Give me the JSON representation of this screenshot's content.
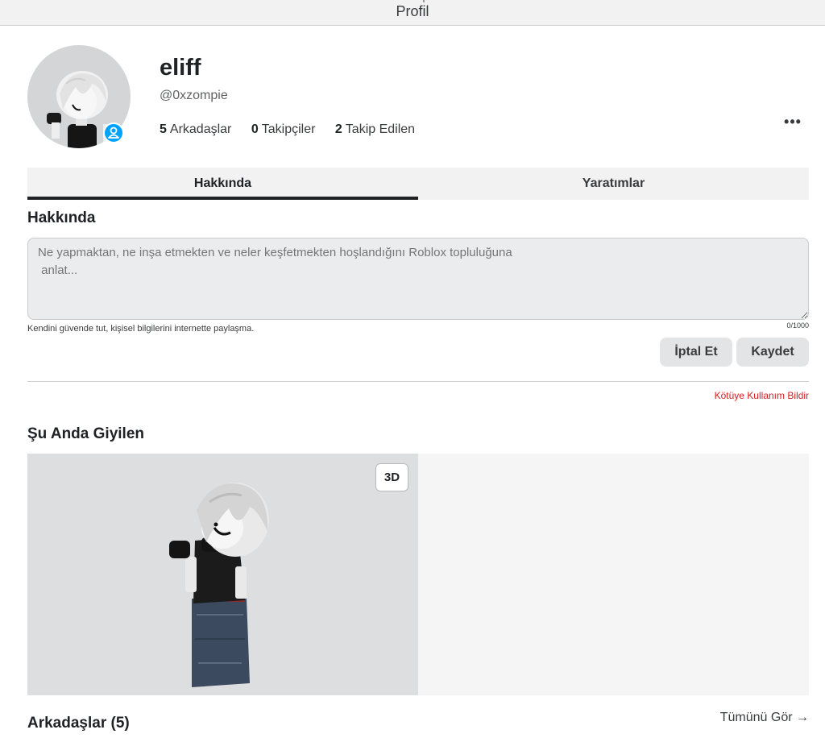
{
  "window": {
    "title": "Profil"
  },
  "profile": {
    "display_name": "eliff",
    "username": "@0xzompie",
    "stats": [
      {
        "count": "5",
        "label": "Arkadaşlar"
      },
      {
        "count": "0",
        "label": "Takipçiler"
      },
      {
        "count": "2",
        "label": "Takip Edilen"
      }
    ],
    "more_label": "•••"
  },
  "tabs": [
    {
      "label": "Hakkında",
      "active": true
    },
    {
      "label": "Yaratımlar",
      "active": false
    }
  ],
  "about": {
    "title": "Hakkında",
    "placeholder": "Ne yapmaktan, ne inşa etmekten ve neler keşfetmekten hoşlandığını Roblox topluluğuna\n anlat...",
    "hint": "Kendini güvende tut, kişisel bilgilerini internette paylaşma.",
    "counter": "0/1000",
    "cancel_label": "İptal Et",
    "save_label": "Kaydet",
    "report_label": "Kötüye Kullanım Bildir"
  },
  "wearing": {
    "title": "Şu Anda Giyilen",
    "view_3d_label": "3D"
  },
  "friends": {
    "title": "Arkadaşlar (5)",
    "see_all_label": "Tümünü Gör →"
  },
  "colors": {
    "presence": "#00a2ff",
    "report": "#d32020",
    "tab_active": "#1f2125"
  }
}
